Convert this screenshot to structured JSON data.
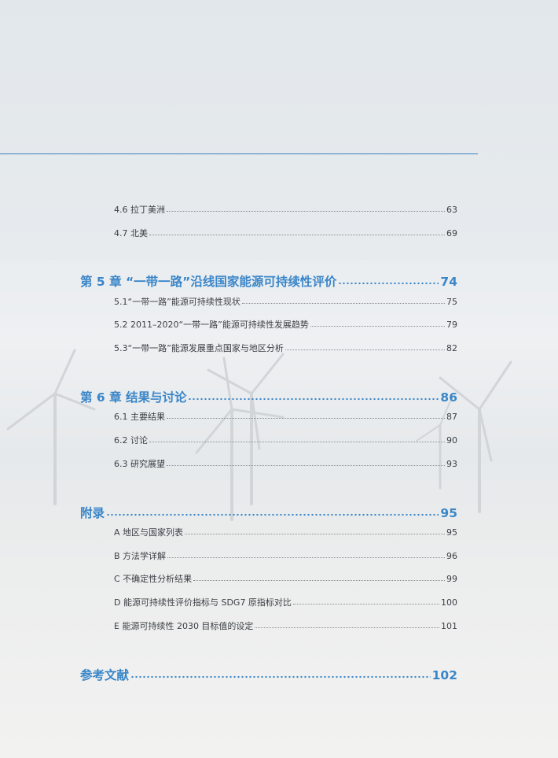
{
  "sections": [
    {
      "level": "sub",
      "label": "4.6 拉丁美洲",
      "page": "63"
    },
    {
      "level": "sub",
      "label": "4.7 北美",
      "page": "69"
    },
    {
      "level": "chapter",
      "label": "第 5 章 “一带一路”沿线国家能源可持续性评价",
      "page": "74"
    },
    {
      "level": "sub",
      "label": "5.1“一带一路”能源可持续性现状",
      "page": "75"
    },
    {
      "level": "sub",
      "label": "5.2 2011–2020“一带一路”能源可持续性发展趋势",
      "page": "79"
    },
    {
      "level": "sub",
      "label": "5.3“一带一路”能源发展重点国家与地区分析",
      "page": "82"
    },
    {
      "level": "chapter",
      "label": "第 6 章 结果与讨论",
      "page": "86"
    },
    {
      "level": "sub",
      "label": "6.1 主要结果",
      "page": "87"
    },
    {
      "level": "sub",
      "label": "6.2 讨论",
      "page": "90"
    },
    {
      "level": "sub",
      "label": "6.3 研究展望",
      "page": "93"
    },
    {
      "level": "chapter",
      "label": "附录",
      "page": "95"
    },
    {
      "level": "sub",
      "label": "A 地区与国家列表",
      "page": "95"
    },
    {
      "level": "sub",
      "label": "B 方法学详解",
      "page": "96"
    },
    {
      "level": "sub",
      "label": "C 不确定性分析结果",
      "page": "99"
    },
    {
      "level": "sub",
      "label": "D 能源可持续性评价指标与 SDG7 原指标对比",
      "page": "100"
    },
    {
      "level": "sub",
      "label": "E 能源可持续性 2030 目标值的设定",
      "page": "101"
    },
    {
      "level": "chapter",
      "label": "参考文献",
      "page": "102"
    }
  ],
  "colors": {
    "accent": "#3a86c8",
    "rule": "#3d7fb8",
    "text": "#3b3f44"
  },
  "background_image": "wind-turbines-offshore"
}
